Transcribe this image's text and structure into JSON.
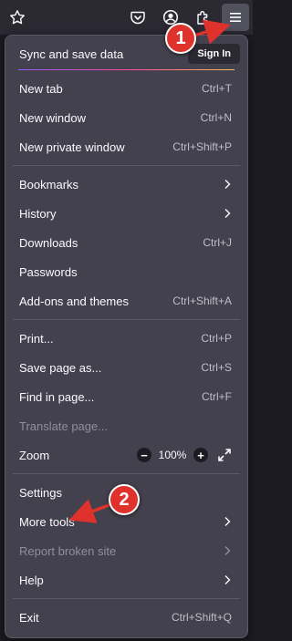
{
  "toolbar": {
    "icons": [
      "star-icon",
      "pocket-icon",
      "account-icon",
      "extensions-icon",
      "hamburger-menu-icon"
    ]
  },
  "menu": {
    "sync": {
      "label": "Sync and save data",
      "signin": "Sign In"
    },
    "items": [
      {
        "label": "New tab",
        "shortcut": "Ctrl+T"
      },
      {
        "label": "New window",
        "shortcut": "Ctrl+N"
      },
      {
        "label": "New private window",
        "shortcut": "Ctrl+Shift+P"
      },
      {
        "label": "Bookmarks",
        "shortcut": ""
      },
      {
        "label": "History",
        "shortcut": ""
      },
      {
        "label": "Downloads",
        "shortcut": "Ctrl+J"
      },
      {
        "label": "Passwords",
        "shortcut": ""
      },
      {
        "label": "Add-ons and themes",
        "shortcut": "Ctrl+Shift+A"
      },
      {
        "label": "Print...",
        "shortcut": "Ctrl+P"
      },
      {
        "label": "Save page as...",
        "shortcut": "Ctrl+S"
      },
      {
        "label": "Find in page...",
        "shortcut": "Ctrl+F"
      },
      {
        "label": "Translate page...",
        "shortcut": "",
        "disabled": true
      },
      {
        "label": "Zoom",
        "shortcut": ""
      },
      {
        "label": "Settings",
        "shortcut": ""
      },
      {
        "label": "More tools",
        "shortcut": ""
      },
      {
        "label": "Report broken site",
        "shortcut": "",
        "disabled": true
      },
      {
        "label": "Help",
        "shortcut": ""
      },
      {
        "label": "Exit",
        "shortcut": "Ctrl+Shift+Q"
      }
    ],
    "zoom": {
      "minus": "−",
      "value": "100%",
      "plus": "+"
    }
  },
  "annotations": [
    {
      "number": "1",
      "color": "#e0322d"
    },
    {
      "number": "2",
      "color": "#e0322d"
    }
  ]
}
